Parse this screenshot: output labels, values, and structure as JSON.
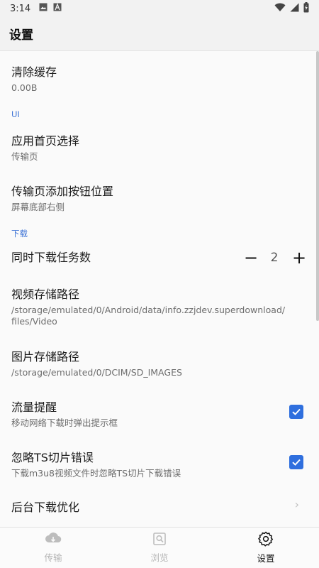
{
  "status_bar": {
    "time": "3:14",
    "icons": [
      "image-icon",
      "text-a-icon",
      "wifi-icon",
      "signal-icon",
      "battery-charging-icon"
    ]
  },
  "app_bar": {
    "title": "设置"
  },
  "settings": {
    "clear_cache": {
      "title": "清除缓存",
      "subtitle": "0.00B"
    },
    "section_ui": "UI",
    "home_page": {
      "title": "应用首页选择",
      "subtitle": "传输页"
    },
    "add_button_position": {
      "title": "传输页添加按钮位置",
      "subtitle": "屏幕底部右侧"
    },
    "section_download": "下载",
    "concurrent_tasks": {
      "title": "同时下载任务数",
      "value": "2",
      "minus": "−",
      "plus": "+"
    },
    "video_path": {
      "title": "视频存储路径",
      "subtitle_line1": "/storage/emulated/0/Android/data/info.zzjdev.superdownload/",
      "subtitle_line2": "files/Video"
    },
    "image_path": {
      "title": "图片存储路径",
      "subtitle": "/storage/emulated/0/DCIM/SD_IMAGES"
    },
    "traffic_alert": {
      "title": "流量提醒",
      "subtitle": "移动网络下载时弹出提示框",
      "checked": true
    },
    "ignore_ts_error": {
      "title": "忽略TS切片错误",
      "subtitle": "下载m3u8视频文件时忽略TS切片下载错误",
      "checked": true
    },
    "background_optimization": {
      "title": "后台下载优化",
      "chevron": "›"
    }
  },
  "bottom_nav": [
    {
      "label": "传输",
      "icon": "cloud-download-icon",
      "active": false
    },
    {
      "label": "浏览",
      "icon": "browse-search-icon",
      "active": false
    },
    {
      "label": "设置",
      "icon": "gear-icon",
      "active": true
    }
  ],
  "colors": {
    "accent": "#2f6fde",
    "section": "#3f74d6",
    "background": "#fafafa",
    "bar": "#f2f2f2"
  }
}
